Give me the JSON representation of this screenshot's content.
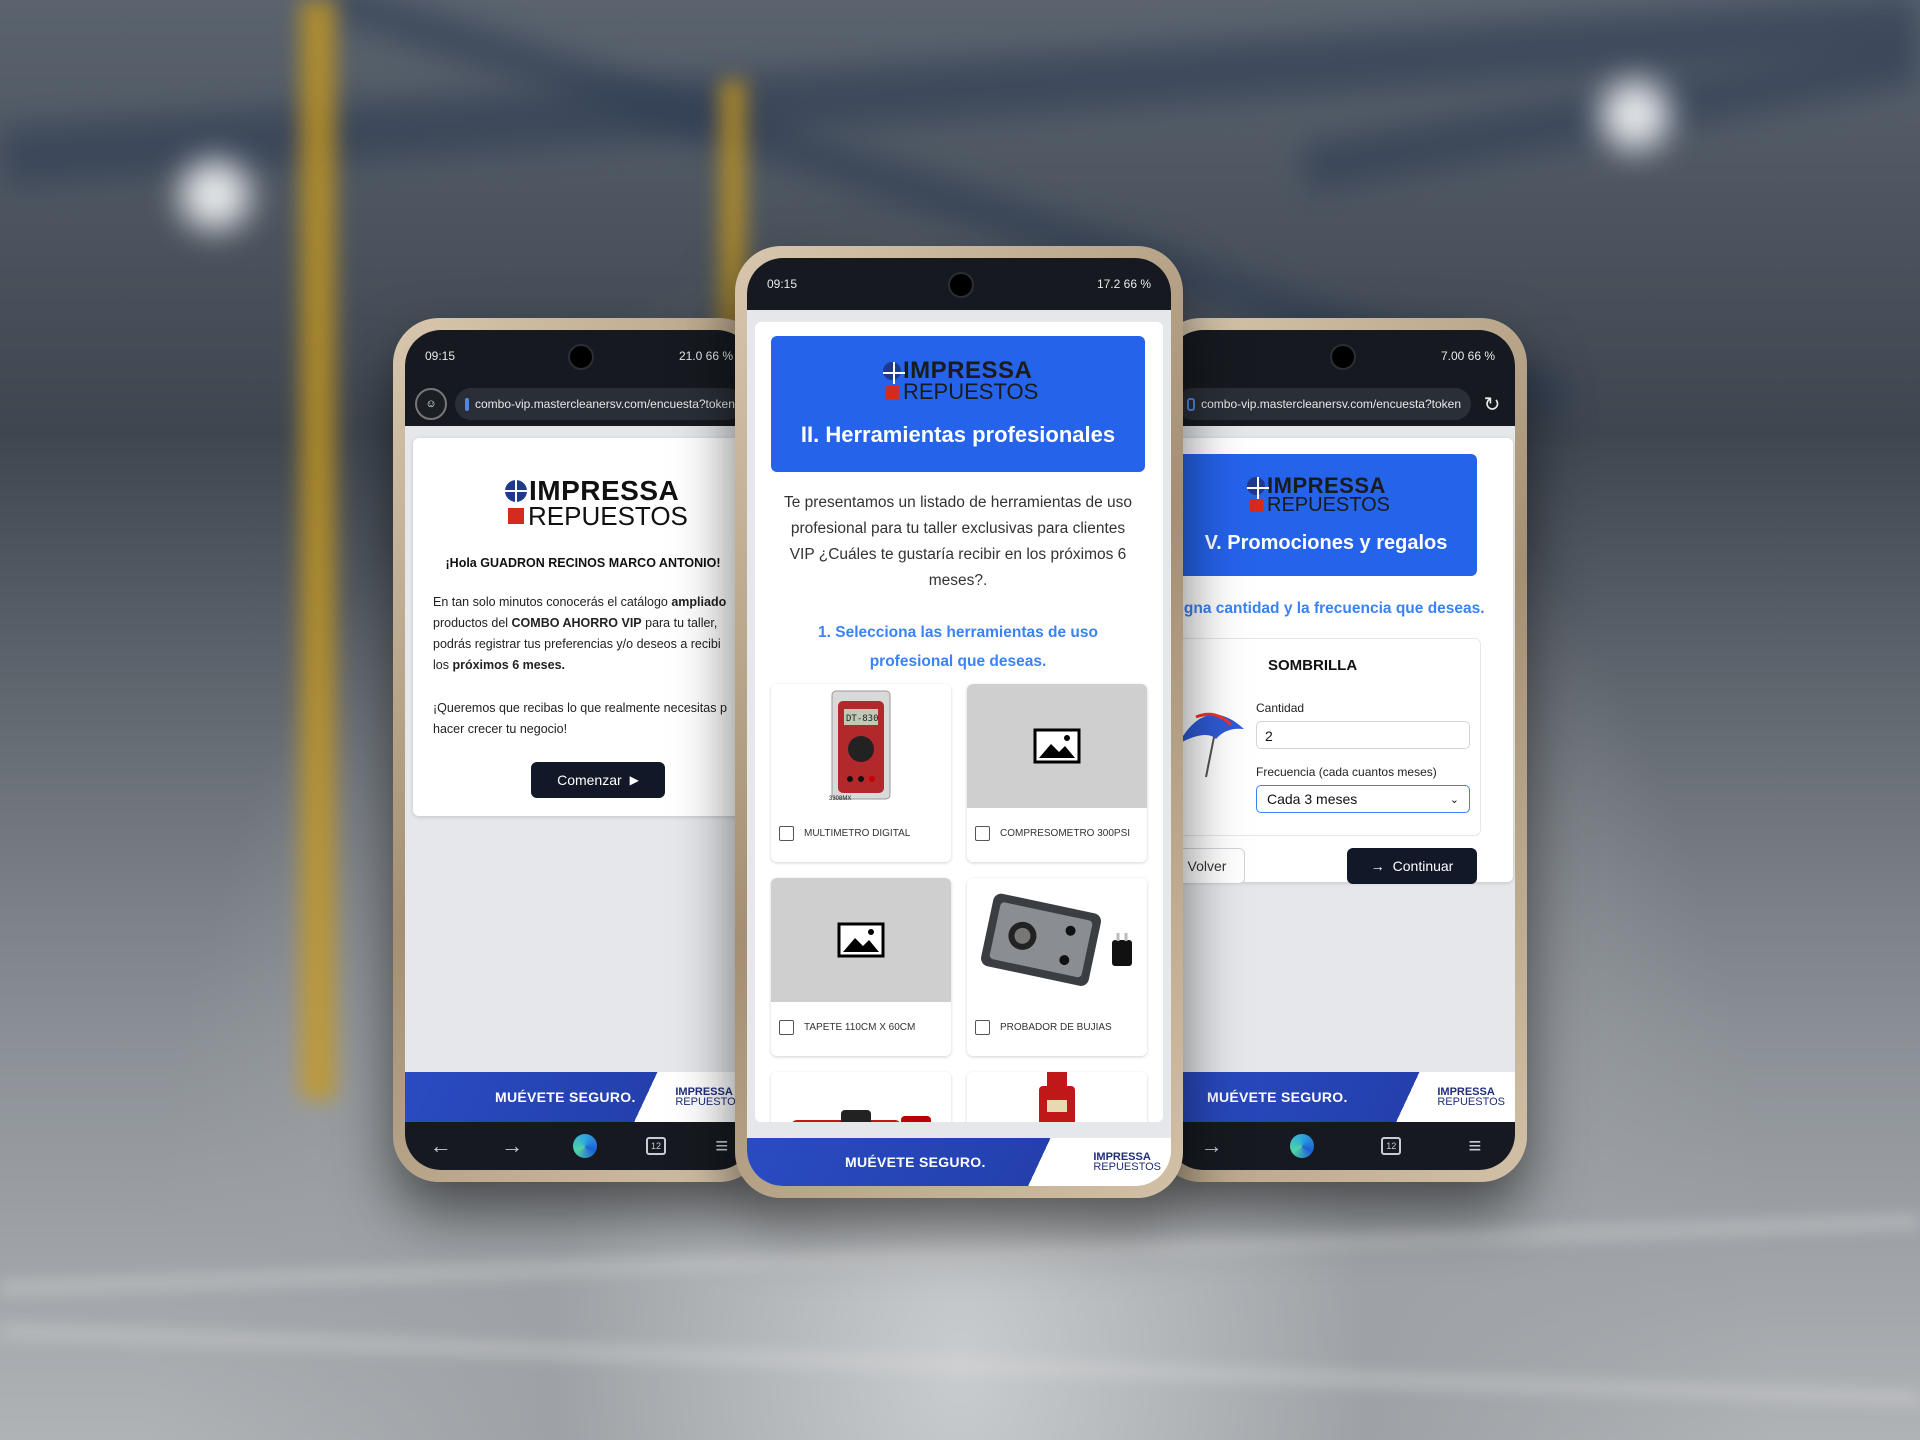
{
  "status_left": {
    "time": "09:15",
    "right": "21.0 66 %"
  },
  "status_center": {
    "time": "09:15",
    "right": "17.2 66 %"
  },
  "status_right": {
    "right": "7.00 66 %"
  },
  "url": "combo-vip.mastercleanersv.com/encuesta?token",
  "brand": {
    "line1": "IMPRESSA",
    "line2": "REPUESTOS",
    "slogan": "MUÉVETE SEGURO."
  },
  "welcome": {
    "greeting": "¡Hola GUADRON RECINOS MARCO ANTONIO!",
    "p1_a": "En tan solo minutos conocerás el catálogo ",
    "p1_b": "ampliado",
    "p1_c": " productos del ",
    "p1_d": "COMBO AHORRO VIP",
    "p1_e": " para tu taller, podrás registrar tus preferencias y/o deseos a recibi los ",
    "p1_f": "próximos 6 meses.",
    "p2": "¡Queremos que recibas lo que realmente necesitas p hacer crecer tu negocio!",
    "start_button": "Comenzar"
  },
  "tools": {
    "title": "II. Herramientas profesionales",
    "intro": "Te presentamos un listado de herramientas de uso profesional para tu taller exclusivas para clientes VIP ¿Cuáles te gustaría recibir en los próximos 6 meses?.",
    "question": "1. Selecciona las herramientas de uso profesional que deseas.",
    "items": [
      {
        "label": "MULTIMETRO DIGITAL",
        "photo_text": "DT-830",
        "photo_caption": "3308MX"
      },
      {
        "label": "COMPRESOMETRO 300PSI"
      },
      {
        "label": "TAPETE 110CM X 60CM"
      },
      {
        "label": "PROBADOR DE BUJIAS"
      }
    ]
  },
  "promos": {
    "title": "V. Promociones y regalos",
    "instruction": "signa cantidad y la frecuencia que deseas.",
    "product": "SOMBRILLA",
    "qty_label": "Cantidad",
    "qty_value": "2",
    "freq_label": "Frecuencia (cada cuantos meses)",
    "freq_value": "Cada 3 meses",
    "back_button": "Volver",
    "continue_button": "Continuar"
  },
  "nav": {
    "tabs_count": "12"
  },
  "icons": [
    "back-arrow-icon",
    "forward-arrow-icon",
    "edge-icon",
    "tabs-icon",
    "menu-icon",
    "reload-icon",
    "lock-icon",
    "image-placeholder-icon",
    "play-icon",
    "arrow-right-icon",
    "arrow-left-icon",
    "chevron-down-icon"
  ],
  "colors": {
    "primary_blue": "#2563eb",
    "question_blue": "#3b82f6",
    "dark_button": "#111827",
    "footer_blue": "#2340ad",
    "logo_red": "#d52b1e"
  }
}
